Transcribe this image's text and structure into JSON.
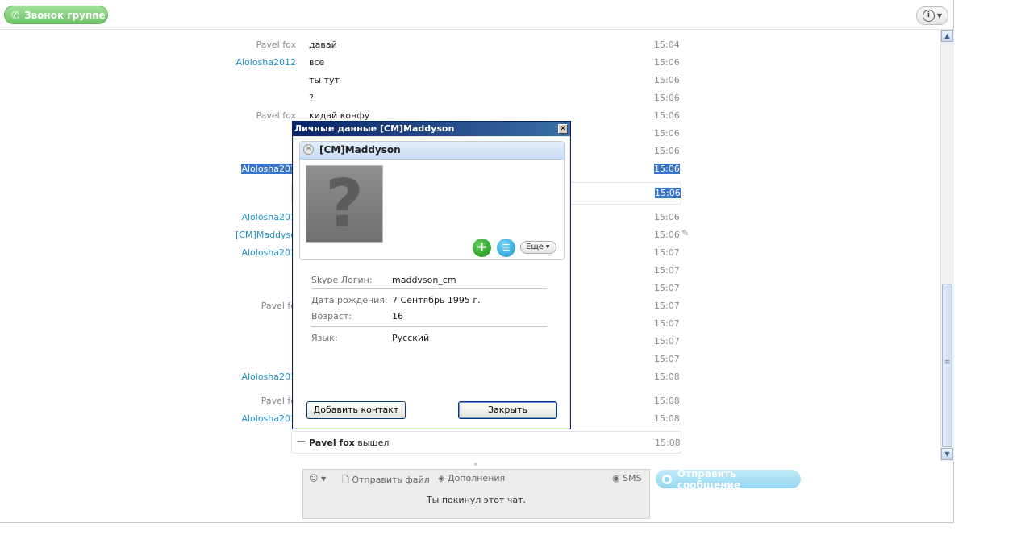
{
  "topbar": {
    "call_group_label": "Звонок группе"
  },
  "chat": {
    "rows": [
      {
        "sender": "Pavel fox",
        "text": "давай",
        "time": "15:04"
      },
      {
        "sender": "Alolosha2012",
        "text": "все",
        "time": "15:06"
      },
      {
        "sender": "",
        "text": "ты тут",
        "time": "15:06"
      },
      {
        "sender": "",
        "text": "?",
        "time": "15:06"
      },
      {
        "sender": "Pavel fox",
        "text": "кидай конфу",
        "time": "15:06"
      },
      {
        "sender": "",
        "text": "",
        "time": "15:06"
      },
      {
        "sender": "",
        "text": "",
        "time": "15:06"
      },
      {
        "sender": "Alolosha201",
        "text": "",
        "time": "15:06"
      },
      {
        "sender": "",
        "text": "",
        "time": "15:06"
      },
      {
        "sender": "Alolosha201",
        "text": "",
        "time": "15:06"
      },
      {
        "sender": "[CM]Maddyso",
        "text": "",
        "time": "15:06"
      },
      {
        "sender": "Alolosha201",
        "text": "",
        "time": "15:07"
      },
      {
        "sender": "",
        "text": "",
        "time": "15:07"
      },
      {
        "sender": "",
        "text": "",
        "time": "15:07"
      },
      {
        "sender": "Pavel fo",
        "text": "",
        "time": "15:07"
      },
      {
        "sender": "",
        "text": "",
        "time": "15:07"
      },
      {
        "sender": "",
        "text": "",
        "time": "15:07"
      },
      {
        "sender": "",
        "text": "",
        "time": "15:07"
      },
      {
        "sender": "Alolosha201",
        "text": "",
        "time": "15:08"
      },
      {
        "sender": "Pavel fo",
        "text": "",
        "time": "15:08"
      },
      {
        "sender": "Alolosha201",
        "text": "",
        "time": "15:08"
      }
    ],
    "left_event": {
      "name": "Pavel fox",
      "action": "вышел",
      "time": "15:08"
    }
  },
  "composer": {
    "send_file": "Отправить файл",
    "extras": "Дополнения",
    "sms": "SMS",
    "status_text": "Ты покинул этот чат.",
    "send_message": "Отправить сообщение"
  },
  "dialog": {
    "title": "Личные данные [CM]Maddyson",
    "contact_name": "[CM]Maddyson",
    "avatar_glyph": "?",
    "more_label": "Еще",
    "fields": {
      "skype_login": {
        "label": "Skype Логин:",
        "value": "maddvson_cm"
      },
      "birthday": {
        "label": "Дата рождения:",
        "value": "7 Сентябрь 1995 г."
      },
      "age": {
        "label": "Возраст:",
        "value": "16"
      },
      "language": {
        "label": "Язык:",
        "value": "Русский"
      }
    },
    "add_contact": "Добавить контакт",
    "close": "Закрыть"
  }
}
